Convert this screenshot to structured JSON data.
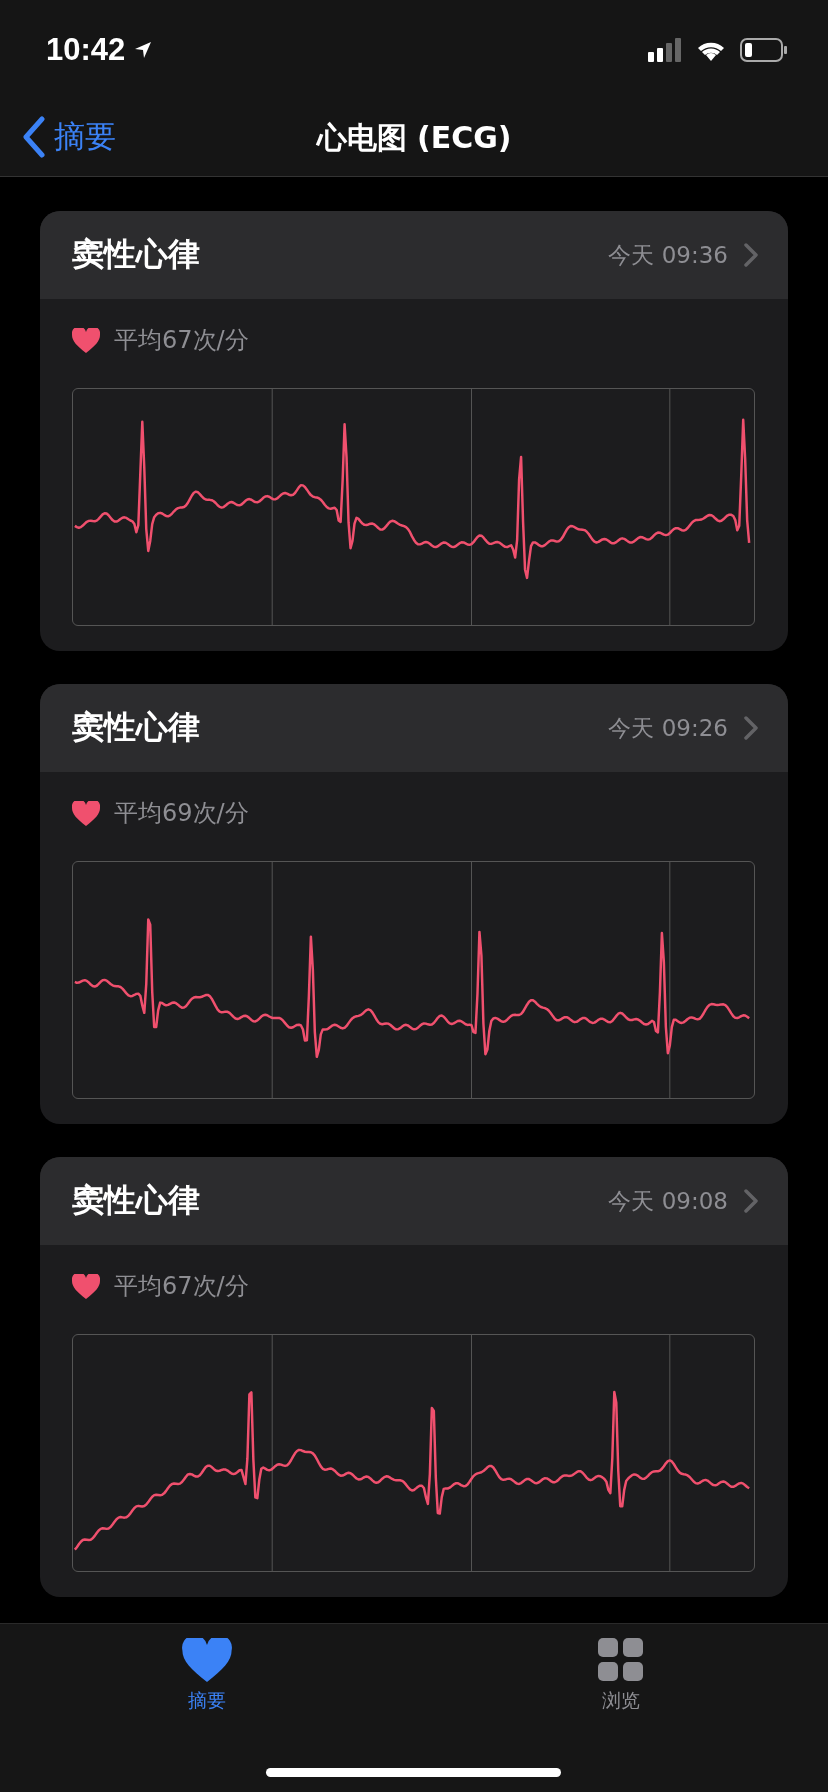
{
  "status_bar": {
    "time": "10:42"
  },
  "nav": {
    "back": "摘要",
    "title": "心电图 (ECG)"
  },
  "recordings": [
    {
      "title": "窦性心律",
      "time": "今天 09:36",
      "average": "平均67次/分"
    },
    {
      "title": "窦性心律",
      "time": "今天 09:26",
      "average": "平均69次/分"
    },
    {
      "title": "窦性心律",
      "time": "今天 09:08",
      "average": "平均67次/分"
    }
  ],
  "tabs": [
    {
      "label": "摘要",
      "selected": true
    },
    {
      "label": "浏览",
      "selected": false
    }
  ]
}
